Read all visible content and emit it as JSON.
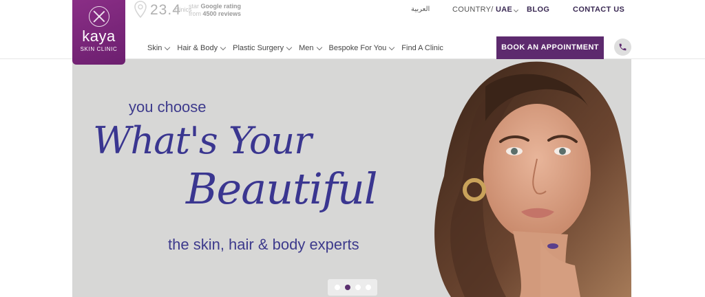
{
  "brand": {
    "name": "kaya",
    "subtitle": "SKIN CLINIC",
    "color": "#6c1f6f"
  },
  "rating": {
    "score": "23.4",
    "ghost": "clinics",
    "line1_prefix": "star",
    "line1_strong": "Google rating",
    "line2_prefix": "from",
    "line2_strong": "4500 reviews"
  },
  "top_links": {
    "arabic": "العربية",
    "country_label": "COUNTRY/",
    "country_value": "UAE",
    "blog": "BLOG",
    "contact": "CONTACT US"
  },
  "nav": [
    {
      "label": "Skin",
      "has_dropdown": true
    },
    {
      "label": "Hair & Body",
      "has_dropdown": true
    },
    {
      "label": "Plastic Surgery",
      "has_dropdown": true
    },
    {
      "label": "Men",
      "has_dropdown": true
    },
    {
      "label": "Bespoke For You",
      "has_dropdown": true
    },
    {
      "label": "Find A Clinic",
      "has_dropdown": false
    }
  ],
  "cta": {
    "book_label": "BOOK AN APPOINTMENT",
    "book_color": "#5d2a6e",
    "phone_icon": "phone-icon"
  },
  "hero": {
    "line1": "you choose",
    "script1": "What's Your",
    "script2": "Beautiful",
    "line2": "the skin, hair & body experts",
    "text_color": "#3a3690",
    "background": "#d7d7d6",
    "slides": 4,
    "active_slide": 2
  }
}
